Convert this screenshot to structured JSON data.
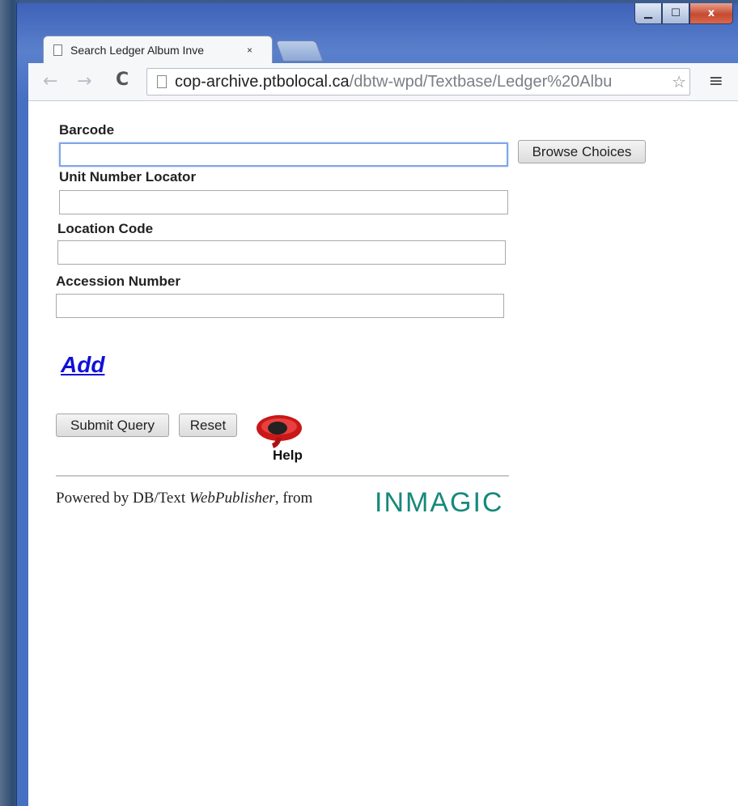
{
  "window": {
    "tab_title": "Search Ledger Album Inve",
    "tab_close": "×",
    "url_host": "cop-archive.ptbolocal.ca",
    "url_path": "/dbtw-wpd/Textbase/Ledger%20Albu",
    "min_glyph": "▁",
    "max_glyph": "☐",
    "close_glyph": "x"
  },
  "form": {
    "barcode_label": "Barcode",
    "barcode_value": "",
    "browse_label": "Browse Choices",
    "unit_label": "Unit Number Locator",
    "unit_value": "",
    "location_label": "Location Code",
    "location_value": "",
    "accession_label": "Accession Number",
    "accession_value": "",
    "add_link": "Add",
    "submit_label": "Submit Query",
    "reset_label": "Reset",
    "help_label": "Help"
  },
  "footer": {
    "powered_prefix": "Powered by DB/Text ",
    "powered_product": "WebPublisher",
    "powered_suffix": ", from",
    "logo_text": "INMAGIC"
  },
  "icons": {
    "back": "back-arrow-icon",
    "forward": "forward-arrow-icon",
    "reload": "reload-icon",
    "star": "star-icon",
    "menu": "menu-icon",
    "help": "help-icon"
  },
  "colors": {
    "link": "#1010d8",
    "logo": "#16897a",
    "focus_border": "#7fa6e6"
  }
}
